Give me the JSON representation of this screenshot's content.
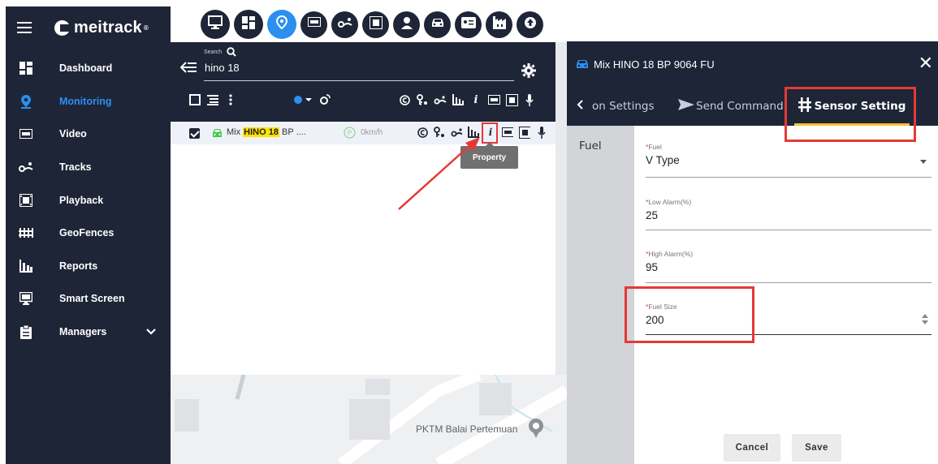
{
  "app": {
    "brand": "meitrack",
    "brand_mark": "®"
  },
  "sidebar": {
    "items": [
      {
        "label": "Dashboard",
        "icon": "dashboard-icon"
      },
      {
        "label": "Monitoring",
        "icon": "location-pin-icon",
        "active": true
      },
      {
        "label": "Video",
        "icon": "live-video-icon"
      },
      {
        "label": "Tracks",
        "icon": "tracks-icon"
      },
      {
        "label": "Playback",
        "icon": "film-icon"
      },
      {
        "label": "GeoFences",
        "icon": "fence-icon"
      },
      {
        "label": "Reports",
        "icon": "bar-chart-icon"
      },
      {
        "label": "Smart Screen",
        "icon": "monitor-icon"
      },
      {
        "label": "Managers",
        "icon": "clipboard-icon"
      }
    ]
  },
  "search": {
    "label": "Search",
    "value": "hino 18"
  },
  "vehicle": {
    "prefix": "Mix",
    "highlight": "HINO 18",
    "suffix": "BP ....",
    "speed": "0km/h"
  },
  "tooltip": {
    "text": "Property"
  },
  "map": {
    "poi": "PKTM Balai Pertemuan"
  },
  "dialog": {
    "title": "Mix HINO 18 BP 9064 FU",
    "close": "✕",
    "tabs": {
      "prev": "on Settings",
      "send": "Send Command",
      "sensor": "Sensor Setting"
    },
    "side_tab": "Fuel",
    "fields": {
      "fuel": {
        "label": "Fuel",
        "value": "V Type"
      },
      "low": {
        "label": "Low Alarm(%)",
        "value": "25"
      },
      "high": {
        "label": "High Alarm(%)",
        "value": "95"
      },
      "size": {
        "label": "Fuel Size",
        "value": "200"
      }
    },
    "buttons": {
      "cancel": "Cancel",
      "save": "Save"
    }
  },
  "colors": {
    "navy": "#1e2537",
    "accent": "#2b8fef",
    "highlight": "#ffe400",
    "annotation": "#e53935"
  }
}
